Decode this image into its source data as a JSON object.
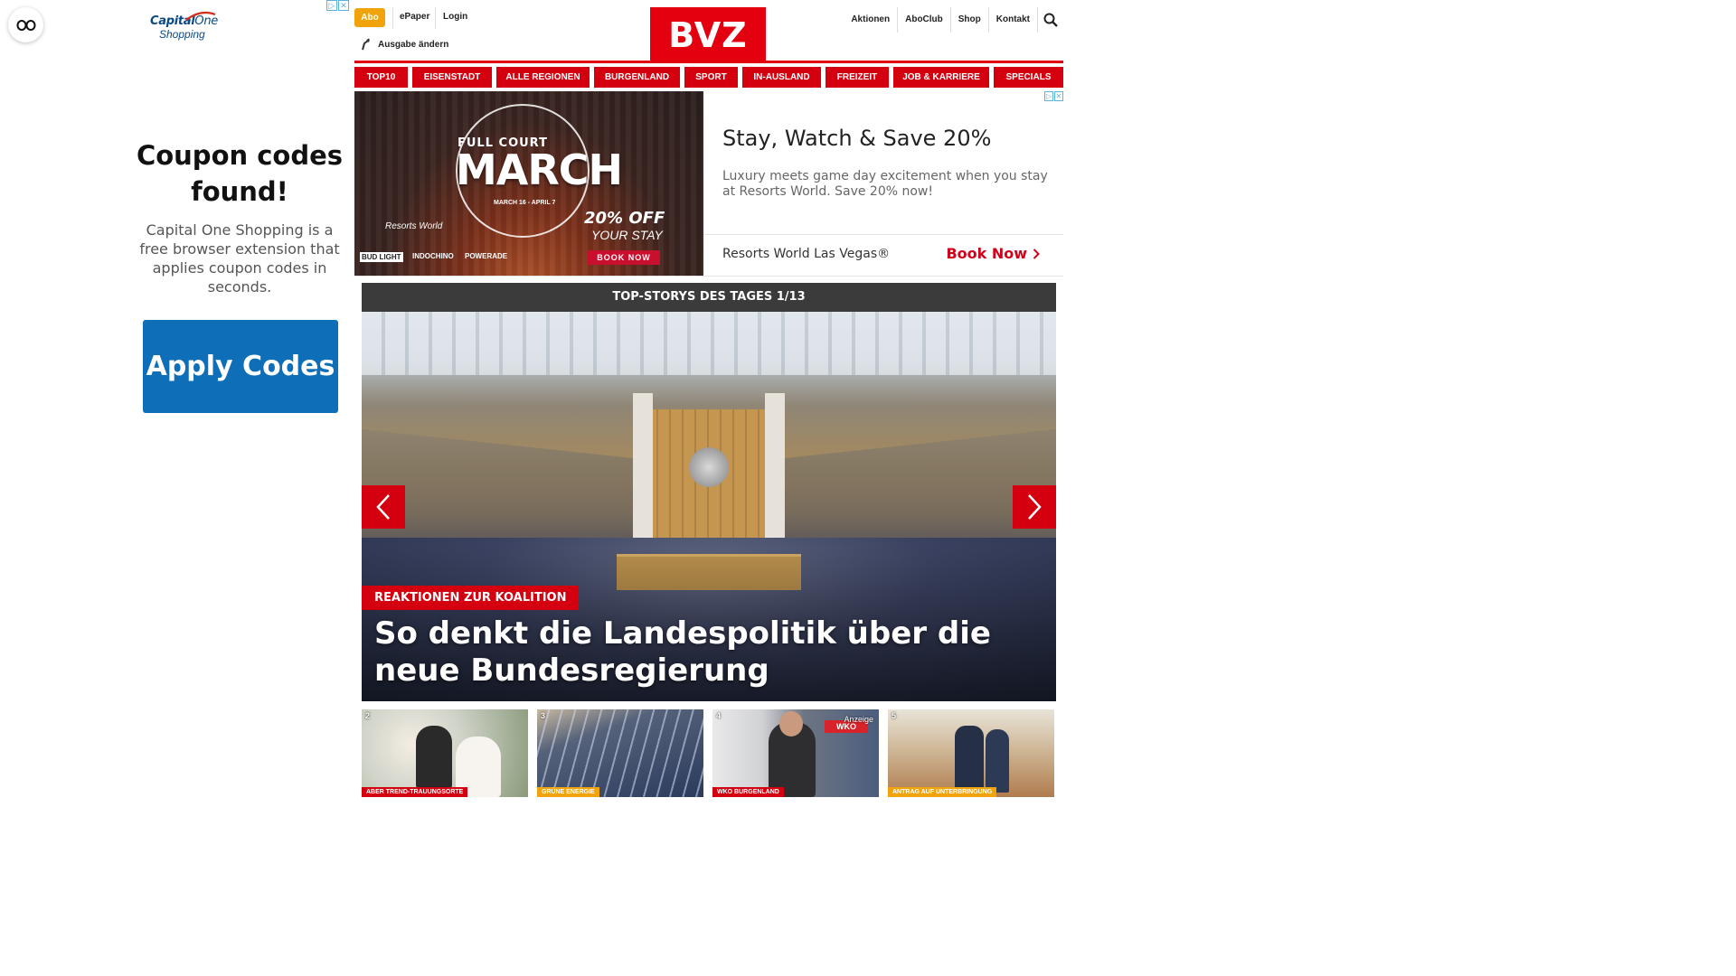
{
  "extension": {
    "icon": "link-glasses-icon"
  },
  "left_ad": {
    "brand_name": "Capital",
    "brand_one": "One",
    "brand_sub": "Shopping",
    "title": "Coupon codes found!",
    "description": "Capital One Shopping is a free browser extension that applies coupon codes in seconds.",
    "button_label": "Apply Codes"
  },
  "header": {
    "abo": "Abo",
    "epaper": "ePaper",
    "login": "Login",
    "edition": "Ausgabe ändern",
    "logo": "BVZ",
    "right_links": [
      "Aktionen",
      "AboClub",
      "Shop",
      "Kontakt"
    ],
    "search_icon": "search-icon"
  },
  "nav": [
    "TOP10",
    "EISENSTADT",
    "ALLE REGIONEN",
    "BURGENLAND",
    "SPORT",
    "IN-AUSLAND",
    "FREIZEIT",
    "JOB & KARRIERE",
    "SPECIALS"
  ],
  "banner": {
    "img_top": "FULL COURT",
    "img_main": "MARCH",
    "img_dates": "MARCH 16 - APRIL 7",
    "img_off": "20% OFF",
    "img_stay": "YOUR STAY",
    "img_rw": "Resorts World",
    "img_book": "BOOK NOW",
    "sponsors": [
      "BUD LIGHT",
      "INDOCHINO",
      "POWERADE"
    ],
    "headline": "Stay, Watch & Save 20%",
    "body": "Luxury meets game day excitement when you stay at Resorts World. Save 20% now!",
    "advertiser": "Resorts World Las Vegas®",
    "cta": "Book Now"
  },
  "top_stories": {
    "header": "TOP-STORYS DES TAGES 1/13",
    "kicker": "REAKTIONEN ZUR KOALITION",
    "title": "So denkt die Landespolitik über die neue Bundesregierung"
  },
  "thumbs": [
    {
      "num": "2",
      "tag": "ABER TREND-TRAUUNGSORTE"
    },
    {
      "num": "3",
      "tag": "GRÜNE ENERGIE"
    },
    {
      "num": "4",
      "tag": "WKO BURGENLAND",
      "extra": "Anzeige",
      "logo": "WKO"
    },
    {
      "num": "5",
      "tag": "ANTRAG AUF UNTERBRINGUNG"
    }
  ],
  "colors": {
    "brand_red": "#e3000f",
    "nav_red": "#d4000f",
    "abo_orange": "#f0a30a",
    "coupon_blue": "#0e6eb7"
  }
}
